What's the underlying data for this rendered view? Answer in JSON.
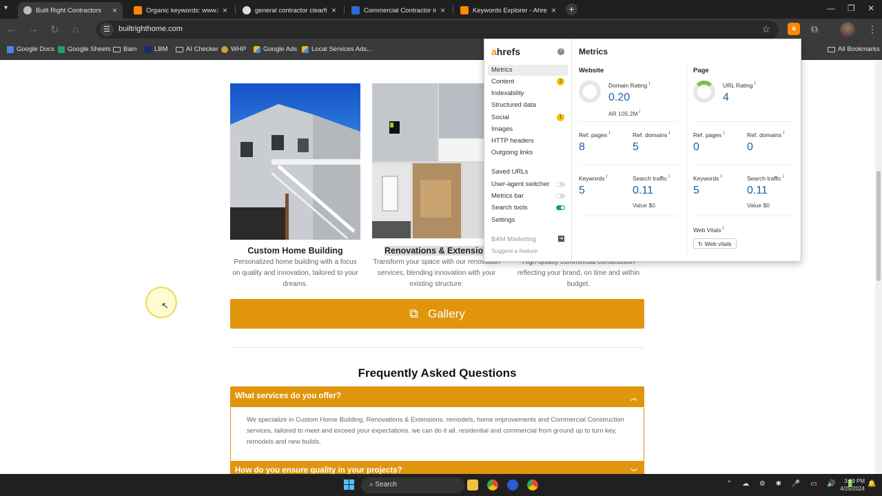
{
  "browser": {
    "tabs": [
      {
        "title": "Built Right Contractors",
        "active": true,
        "favicon_color": "#bbbbbb"
      },
      {
        "title": "Organic keywords: www.buil",
        "active": false,
        "favicon_color": "#ff8800"
      },
      {
        "title": "general contractor clearfield",
        "active": false,
        "favicon_color": "#dddddd"
      },
      {
        "title": "Commercial Contractor in Cl",
        "active": false,
        "favicon_color": "#2a6bd6"
      },
      {
        "title": "Keywords Explorer - Ahrefs",
        "active": false,
        "favicon_color": "#ff8800"
      }
    ],
    "new_tab_glyph": "+",
    "tab_close_glyph": "×",
    "url": "builtrighthome.com",
    "bookmarks": [
      {
        "label": "Google Docs",
        "icon": "docs-icon"
      },
      {
        "label": "Google Sheets",
        "icon": "sheets-icon"
      },
      {
        "label": "Bam",
        "icon": "folder-icon"
      },
      {
        "label": "LBM",
        "icon": "lbm-icon"
      },
      {
        "label": "AI Checker",
        "icon": "folder-icon"
      },
      {
        "label": "WHP",
        "icon": "whp-icon"
      },
      {
        "label": "Google Ads",
        "icon": "google-ads-icon"
      },
      {
        "label": "Local Services Ads...",
        "icon": "google-ads-icon"
      }
    ],
    "all_bookmarks": "All Bookmarks"
  },
  "page": {
    "cards": [
      {
        "title": "Custom Home Building",
        "desc": "Personalized home building with a focus on quality and innovation, tailored to your dreams."
      },
      {
        "title": "Renovations & Extensions",
        "desc": "Transform your space with our renovation services, blending innovation with your existing structure."
      },
      {
        "title": "",
        "desc": "High-quality commercial construction reflecting your brand, on time and within budget."
      }
    ],
    "gallery_label": "Gallery",
    "faq_title": "Frequently Asked Questions",
    "faq": [
      {
        "q": "What services do you offer?",
        "a": "We specialize in Custom Home Building, Renovations & Extensions, remodels, home improvements and Commercial Construction services, tailored to meet and exceed your expectations. we can do it all, residential and commercial from ground up to turn key, remodels and new builds."
      },
      {
        "q": "How do you ensure quality in your projects?",
        "a": ""
      }
    ]
  },
  "ahrefs": {
    "logo_a": "a",
    "logo_rest": "hrefs",
    "menu": [
      {
        "label": "Metrics",
        "selected": true
      },
      {
        "label": "Content",
        "badge": "2"
      },
      {
        "label": "Indexability"
      },
      {
        "label": "Structured data"
      },
      {
        "label": "Social",
        "badge": "1"
      },
      {
        "label": "Images"
      },
      {
        "label": "HTTP headers"
      },
      {
        "label": "Outgoing links"
      }
    ],
    "menu2": [
      {
        "label": "Saved URLs"
      },
      {
        "label": "User-agent switcher",
        "toggle": "off"
      },
      {
        "label": "Metrics bar",
        "toggle": "off"
      },
      {
        "label": "Search tools",
        "toggle": "on"
      },
      {
        "label": "Settings"
      }
    ],
    "account": "BAM Marketing",
    "suggest": "Suggest a feature",
    "metrics_title": "Metrics",
    "website": {
      "heading": "Website",
      "dr_label": "Domain Rating",
      "dr_value": "0.20",
      "ar": "AR 105.2M",
      "ref_pages_label": "Ref. pages",
      "ref_pages": "8",
      "ref_domains_label": "Ref. domains",
      "ref_domains": "5",
      "keywords_label": "Keywords",
      "keywords": "5",
      "traffic_label": "Search traffic",
      "traffic": "0.11",
      "value": "Value $0"
    },
    "page": {
      "heading": "Page",
      "ur_label": "URL Rating",
      "ur_value": "4",
      "ref_pages_label": "Ref. pages",
      "ref_pages": "0",
      "ref_domains_label": "Ref. domains",
      "ref_domains": "0",
      "keywords_label": "Keywords",
      "keywords": "5",
      "traffic_label": "Search traffic",
      "traffic": "0.11",
      "value": "Value $0",
      "web_vitals_label": "Web Vitals",
      "web_vitals_button": "Web vitals"
    }
  },
  "taskbar": {
    "search_label": "Search",
    "time": "3:19 PM",
    "date": "4/25/2024"
  }
}
